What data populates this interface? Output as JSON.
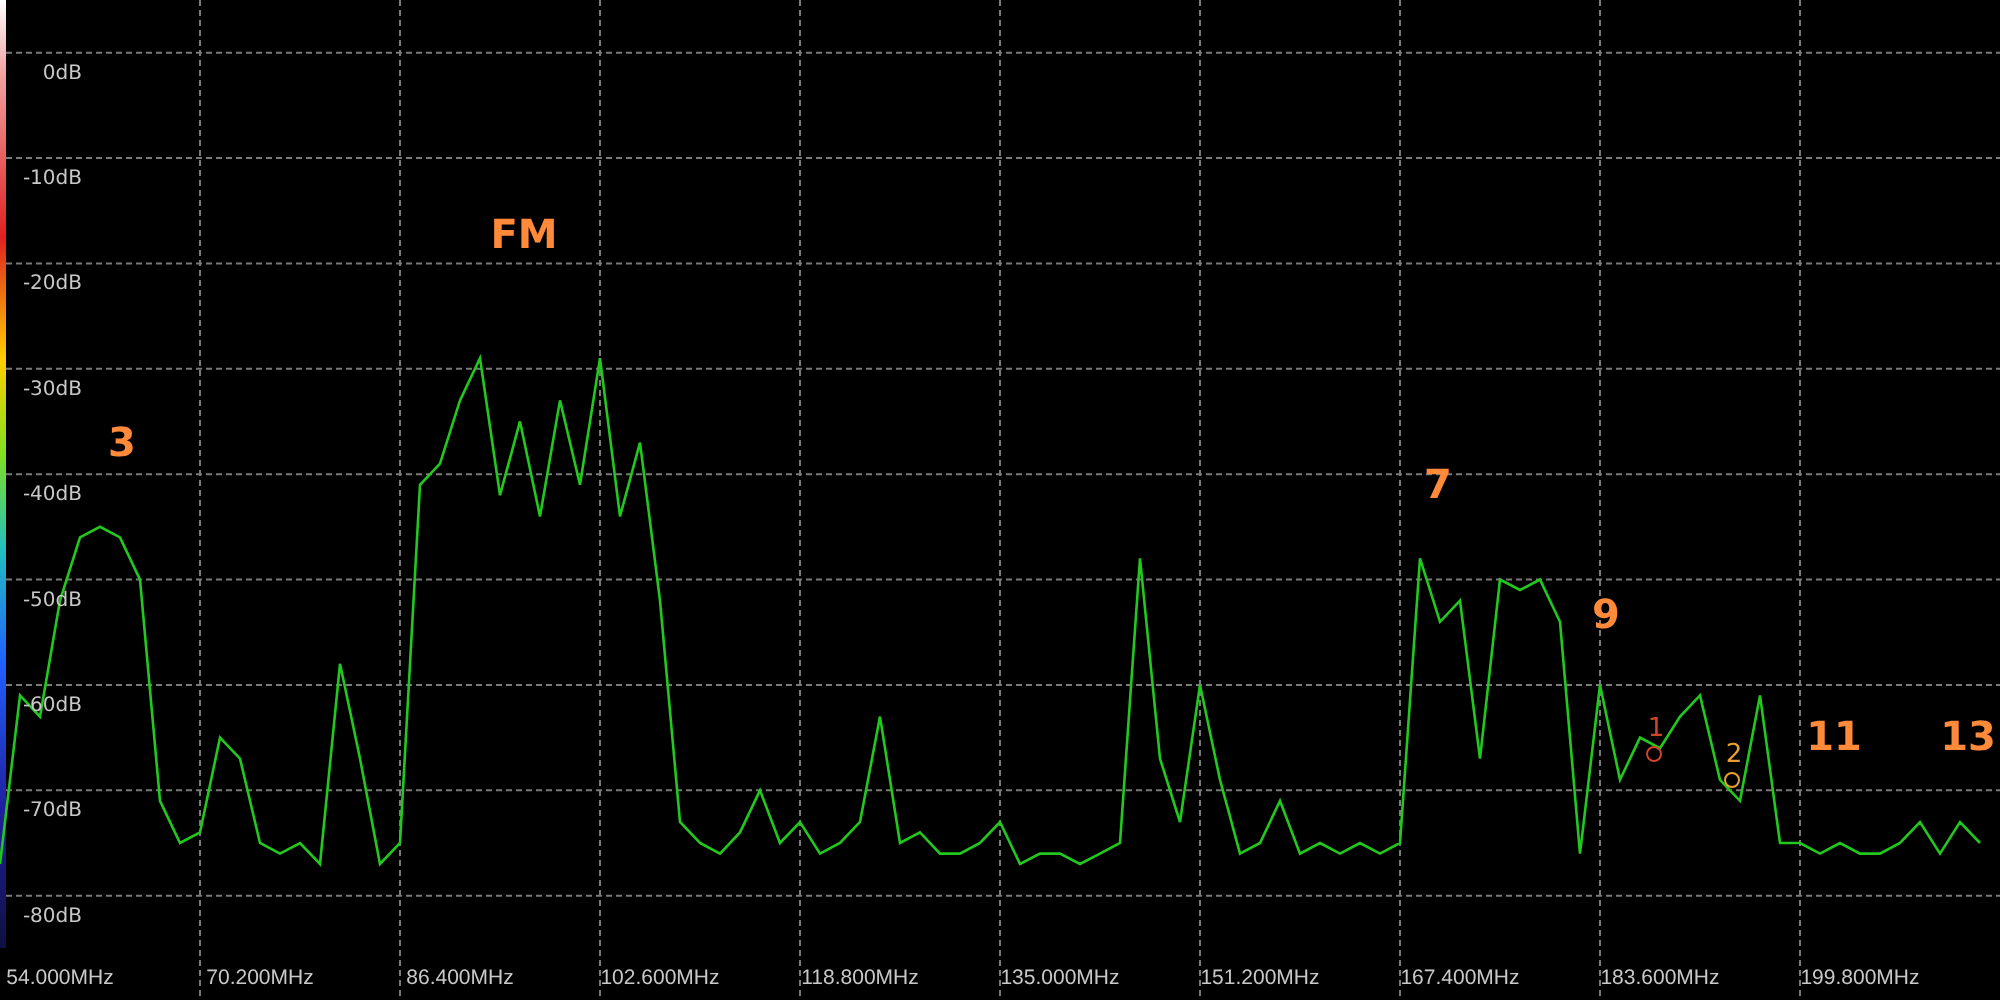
{
  "spectrum": {
    "chart_data": {
      "type": "line",
      "grid": true,
      "ylim": [
        -89.9,
        5
      ],
      "yticks": [
        {
          "value": 0,
          "label": "0dB"
        },
        {
          "value": -10,
          "label": "-10dB"
        },
        {
          "value": -20,
          "label": "-20dB"
        },
        {
          "value": -30,
          "label": "-30dB"
        },
        {
          "value": -40,
          "label": "-40dB"
        },
        {
          "value": -50,
          "label": "-50dB"
        },
        {
          "value": -60,
          "label": "-60dB"
        },
        {
          "value": -70,
          "label": "-70dB"
        },
        {
          "value": -80,
          "label": "-80dB"
        }
      ],
      "categories": [
        null,
        null,
        null,
        "54.000MHz",
        null,
        null,
        null,
        null,
        null,
        null,
        null,
        null,
        null,
        "70.200MHz",
        null,
        null,
        null,
        null,
        null,
        null,
        null,
        null,
        null,
        "86.400MHz",
        null,
        null,
        null,
        null,
        null,
        null,
        null,
        null,
        null,
        "102.600MHz",
        null,
        null,
        null,
        null,
        null,
        null,
        null,
        null,
        null,
        "118.800MHz",
        null,
        null,
        null,
        null,
        null,
        null,
        null,
        null,
        null,
        "135.000MHz",
        null,
        null,
        null,
        null,
        null,
        null,
        null,
        null,
        null,
        "151.200MHz",
        null,
        null,
        null,
        null,
        null,
        null,
        null,
        null,
        null,
        "167.400MHz",
        null,
        null,
        null,
        null,
        null,
        null,
        null,
        null,
        null,
        "183.600MHz",
        null,
        null,
        null,
        null,
        null,
        null,
        null,
        null,
        null,
        "199.800MHz",
        null,
        null,
        null,
        null,
        null,
        null
      ],
      "series": [
        {
          "color": "#22c81e",
          "values": [
            -77,
            -61,
            -63,
            -52,
            -46,
            -45,
            -46,
            -50,
            -71,
            -75,
            -74,
            -65,
            -67,
            -75,
            -76,
            -75,
            -77,
            -58,
            -67,
            -77,
            -75,
            -41,
            -39,
            -33,
            -29,
            -42,
            -35,
            -44,
            -33,
            -41,
            -29,
            -44,
            -37,
            -52,
            -73,
            -75,
            -76,
            -74,
            -70,
            -75,
            -73,
            -76,
            -75,
            -73,
            -63,
            -75,
            -74,
            -76,
            -76,
            -75,
            -73,
            -77,
            -76,
            -76,
            -77,
            -76,
            -75,
            -48,
            -67,
            -73,
            -60,
            -69,
            -76,
            -75,
            -71,
            -76,
            -75,
            -76,
            -75,
            -76,
            -75,
            -48,
            -54,
            -52,
            -67,
            -50,
            -51,
            -50,
            -54,
            -76,
            -60,
            -69,
            -65,
            -66,
            -63,
            -61,
            -69,
            -71,
            -61,
            -75,
            -75,
            -76,
            -75,
            -76,
            -76,
            -75,
            -73,
            -76,
            -73,
            -75
          ]
        }
      ],
      "annotations": [
        "3",
        "FM",
        "7",
        "9",
        "11",
        "13"
      ]
    },
    "markers": [
      {
        "label": "1",
        "color": "#d0442c"
      },
      {
        "label": "2",
        "color": "#e8a032"
      }
    ]
  }
}
